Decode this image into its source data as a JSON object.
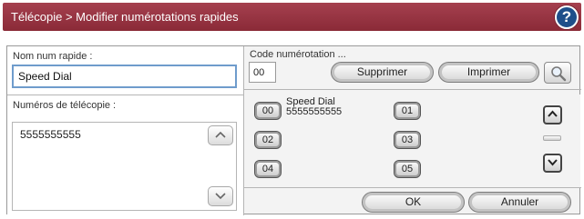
{
  "titlebar": {
    "title": "Télécopie > Modifier numérotations rapides",
    "help_glyph": "?",
    "colors": {
      "bar": "#8a2a37",
      "help": "#1e4f8a"
    }
  },
  "left": {
    "name_label": "Nom num rapide :",
    "name_value": "Speed Dial",
    "fax_label": "Numéros de télécopie :",
    "fax_value": "5555555555"
  },
  "right": {
    "code_label": "Code numérotation ...",
    "code_value": "00",
    "delete_label": "Supprimer",
    "print_label": "Imprimer",
    "search_icon": "magnifier-icon"
  },
  "entries": [
    {
      "code": "00",
      "name": "Speed Dial",
      "number": "5555555555"
    },
    {
      "code": "01",
      "name": "",
      "number": ""
    },
    {
      "code": "02",
      "name": "",
      "number": ""
    },
    {
      "code": "03",
      "name": "",
      "number": ""
    },
    {
      "code": "04",
      "name": "",
      "number": ""
    },
    {
      "code": "05",
      "name": "",
      "number": ""
    }
  ],
  "actions": {
    "ok_label": "OK",
    "cancel_label": "Annuler"
  },
  "icons": {
    "up": "▲",
    "down": "▼",
    "chev_up": "︿",
    "chev_down": "﹀"
  }
}
